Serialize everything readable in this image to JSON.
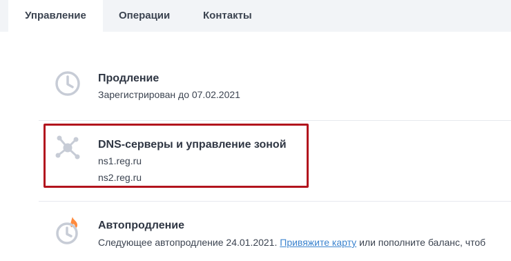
{
  "tabs": [
    {
      "label": "Управление",
      "active": true
    },
    {
      "label": "Операции",
      "active": false
    },
    {
      "label": "Контакты",
      "active": false
    }
  ],
  "renewal": {
    "title": "Продление",
    "subtitle": "Зарегистрирован до 07.02.2021",
    "icon": "clock-icon"
  },
  "dns": {
    "title": "DNS-серверы и управление зоной",
    "servers": [
      "ns1.reg.ru",
      "ns2.reg.ru"
    ],
    "icon": "network-nodes-icon"
  },
  "autorenew": {
    "title": "Автопродление",
    "text_before": "Следующее автопродление 24.01.2021. ",
    "link": "Привяжите карту",
    "text_after": " или пополните баланс, чтоб",
    "icon": "clock-fire-icon"
  },
  "colors": {
    "accent_link": "#3c84cf",
    "highlight_border": "#b2141d",
    "icon_gray": "#c7ccd6"
  }
}
